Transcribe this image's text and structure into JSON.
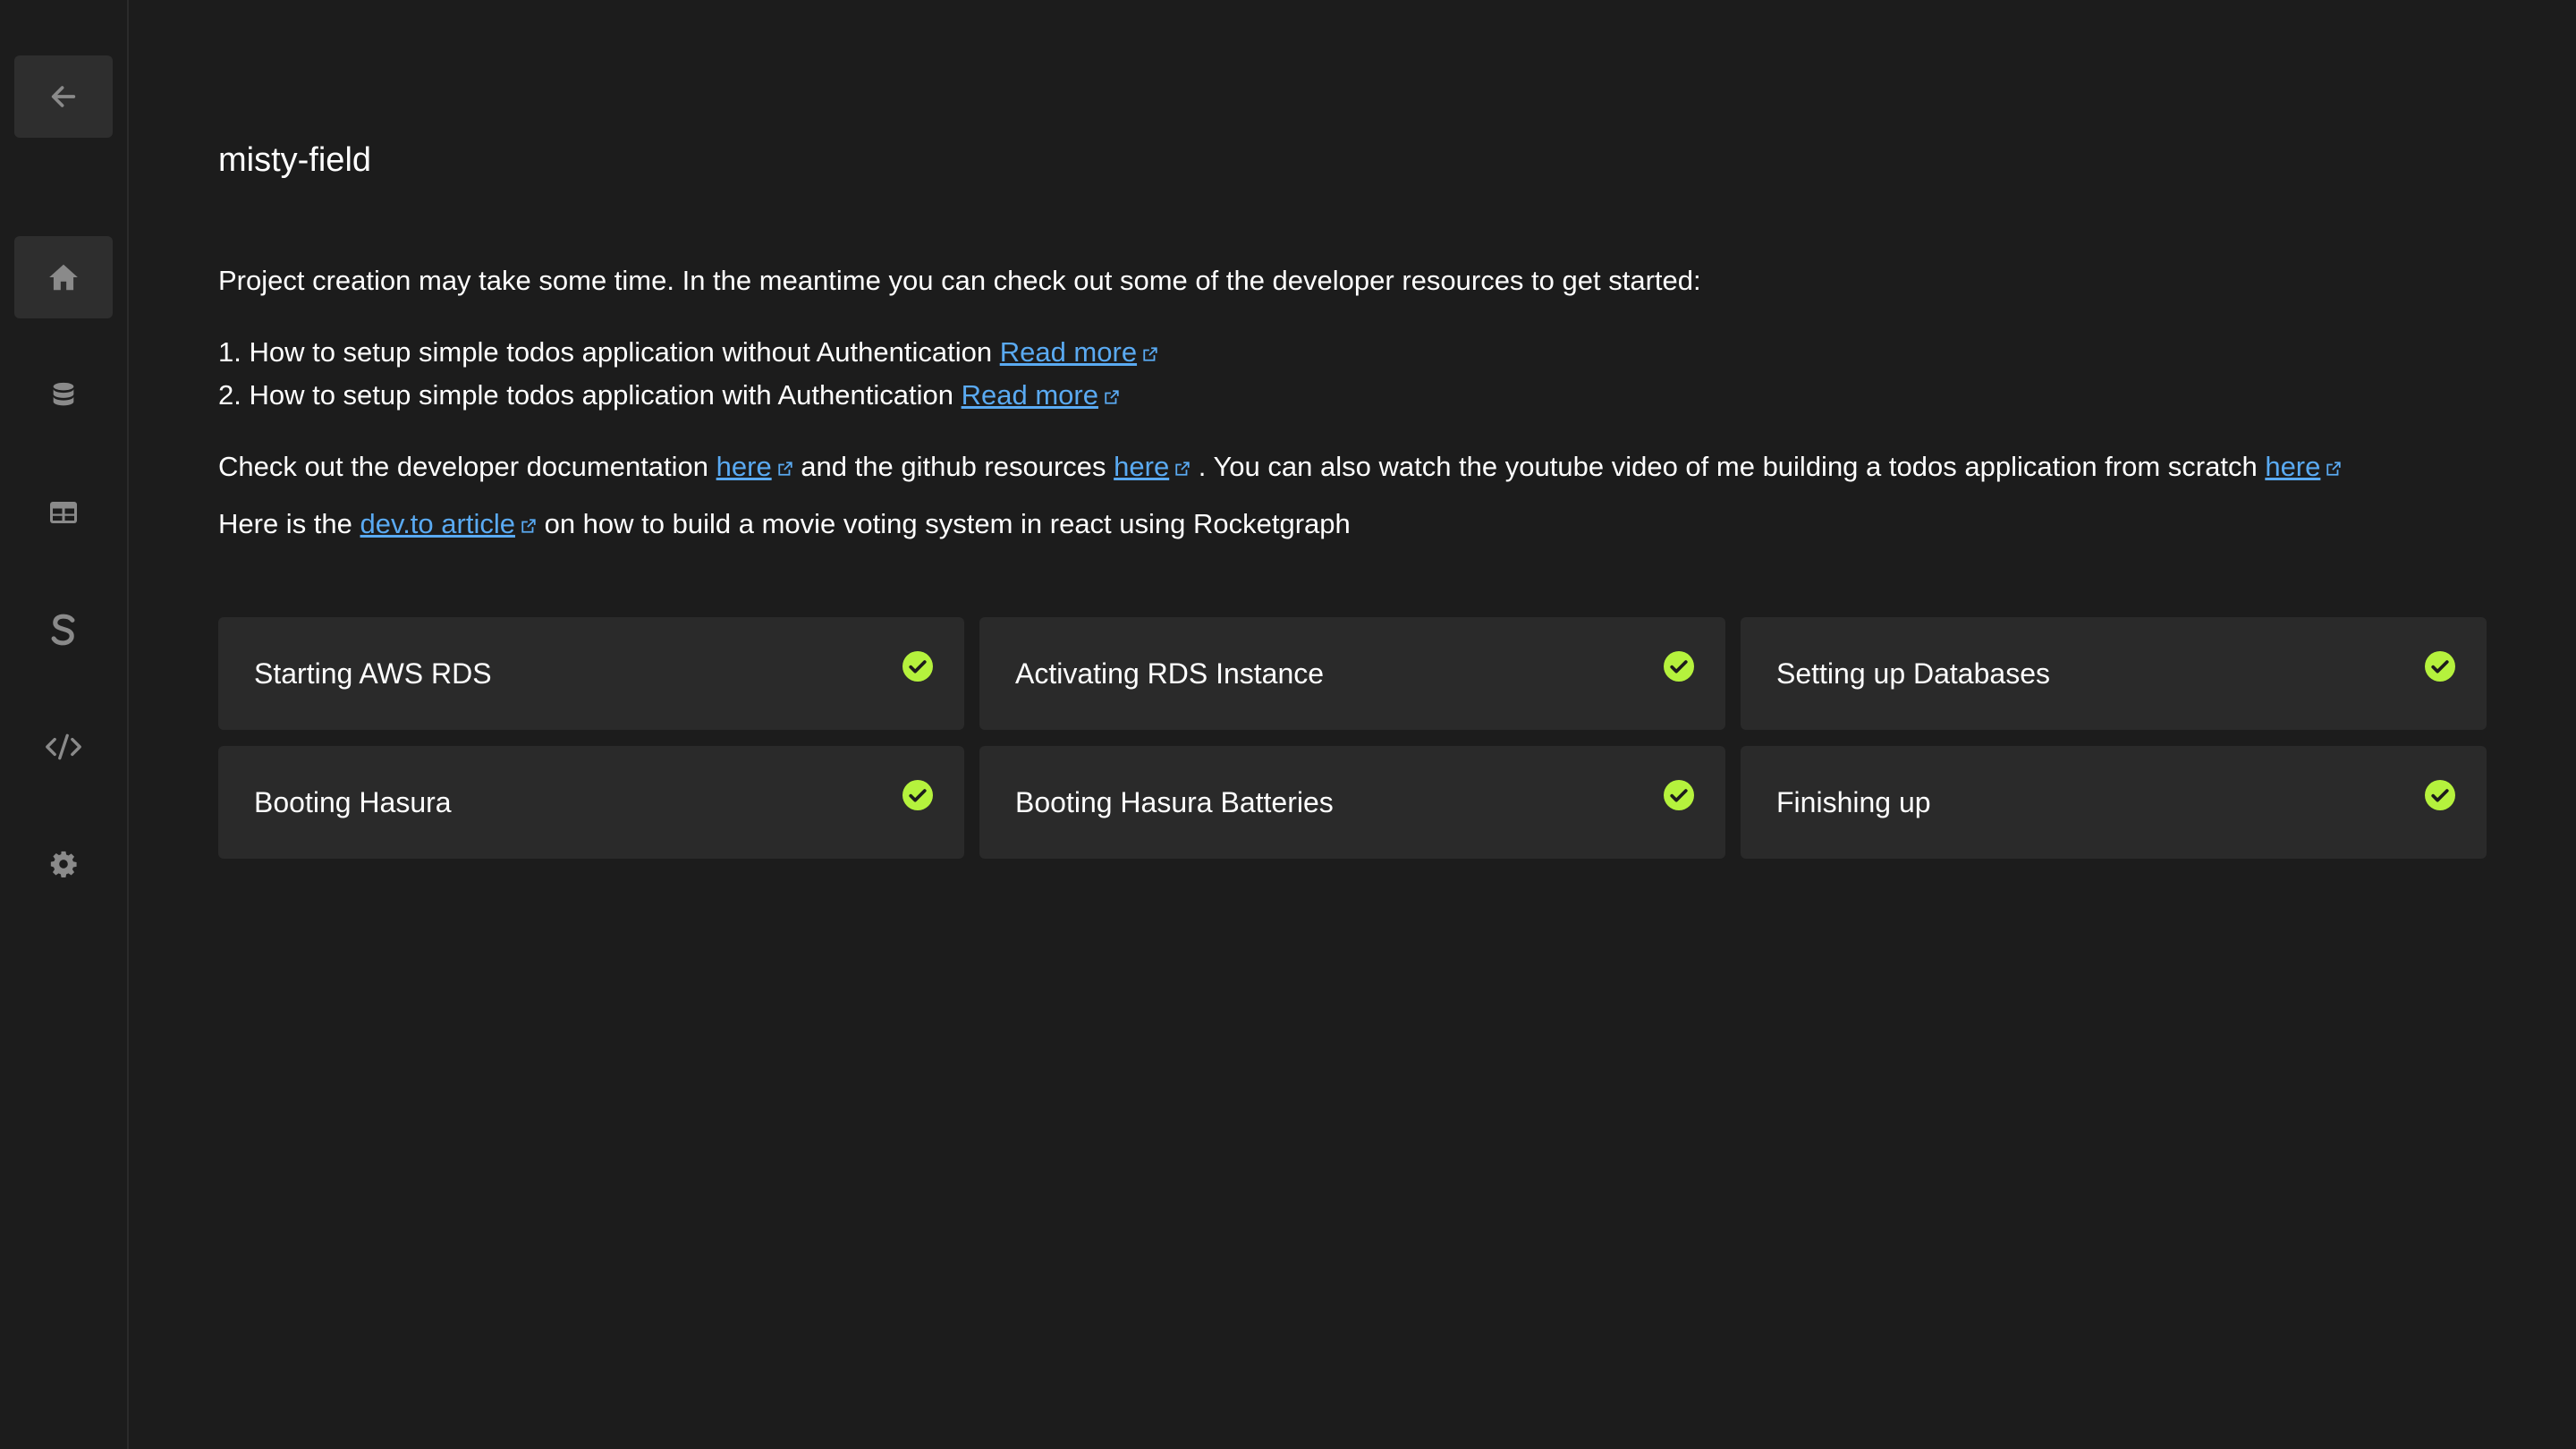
{
  "project": {
    "name": "misty-field"
  },
  "sidebar": {
    "items": [
      {
        "icon": "arrow-left-icon",
        "active": false
      },
      {
        "icon": "home-icon",
        "active": true
      },
      {
        "icon": "database-icon",
        "active": false
      },
      {
        "icon": "table-icon",
        "active": false
      },
      {
        "icon": "storage-s-icon",
        "active": false
      },
      {
        "icon": "code-icon",
        "active": false
      },
      {
        "icon": "gear-icon",
        "active": false
      }
    ]
  },
  "intro": {
    "text": "Project creation may take some time. In the meantime you can check out some of the developer resources to get started:"
  },
  "resources": [
    {
      "text": "1. How to setup simple todos application without Authentication ",
      "link": "Read more"
    },
    {
      "text": "2. How to setup simple todos application with Authentication ",
      "link": "Read more"
    }
  ],
  "docs_line": {
    "t1": "Check out the developer documentation ",
    "link1": "here",
    "t2": " and the github resources ",
    "link2": "here",
    "t3": " . You can also watch the youtube video of me building a todos application from scratch ",
    "link3": "here"
  },
  "article_line": {
    "t1": "Here is the ",
    "link": "dev.to article",
    "t2": " on how to build a movie voting system in react using Rocketgraph"
  },
  "steps": [
    {
      "label": "Starting AWS RDS",
      "done": true
    },
    {
      "label": "Activating RDS Instance",
      "done": true
    },
    {
      "label": "Setting up Databases",
      "done": true
    },
    {
      "label": "Booting Hasura",
      "done": true
    },
    {
      "label": "Booting Hasura Batteries",
      "done": true
    },
    {
      "label": "Finishing up",
      "done": true
    }
  ],
  "colors": {
    "background": "#1c1c1c",
    "card": "#2a2a2a",
    "link": "#5aaaf2",
    "check": "#b5f23d"
  }
}
